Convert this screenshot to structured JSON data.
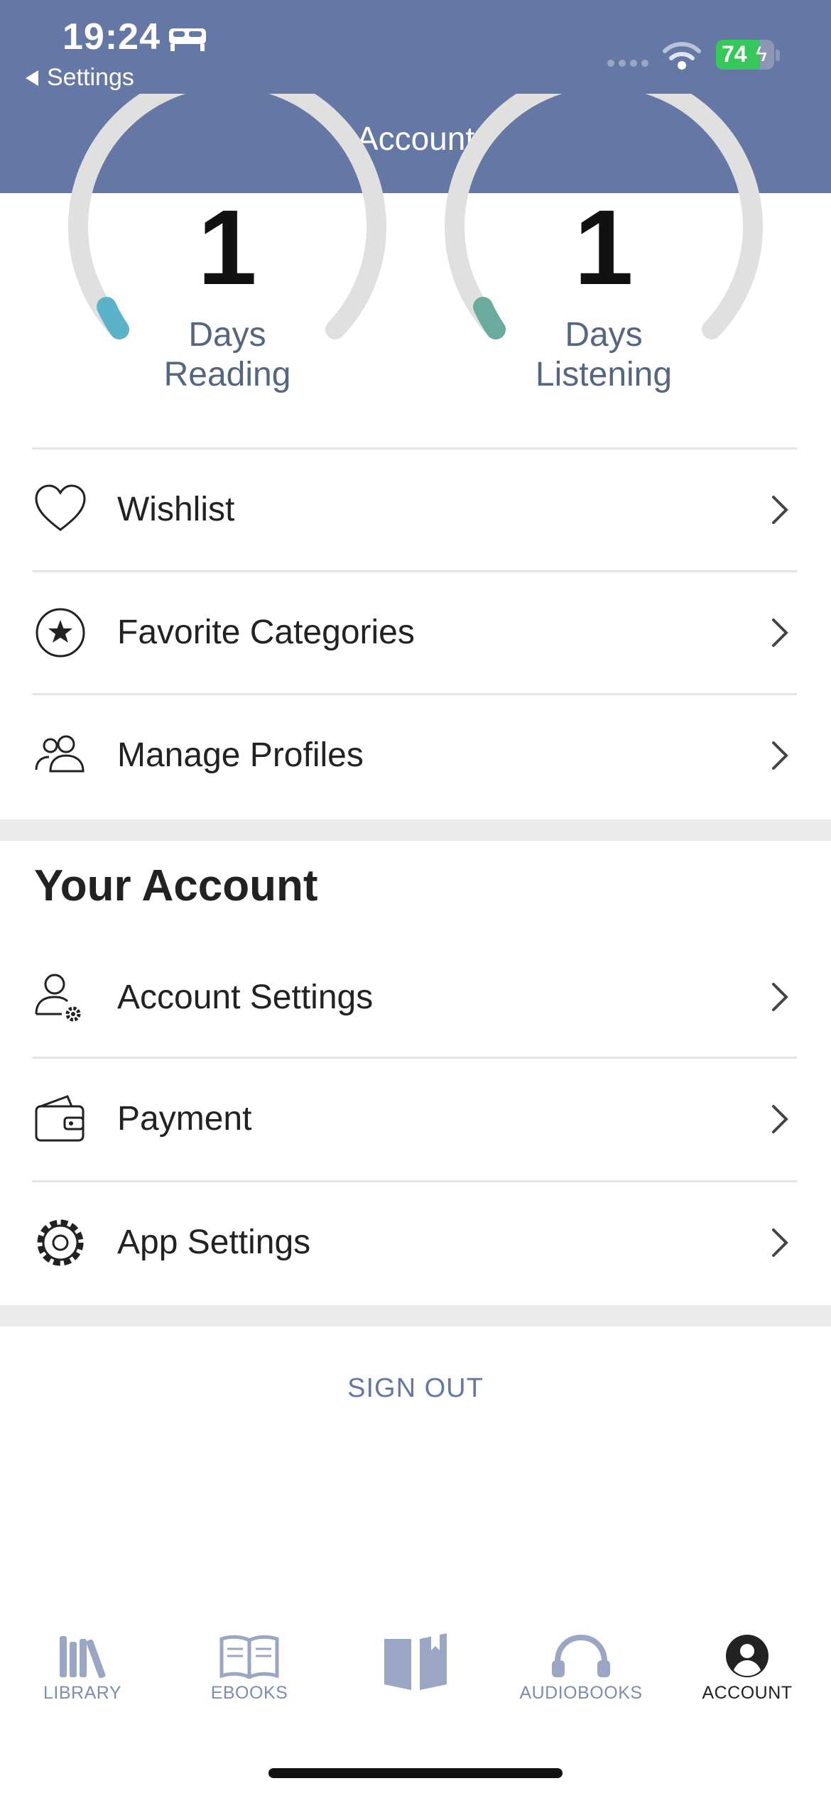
{
  "status_bar": {
    "time": "19:24",
    "back_label": "Settings",
    "battery": "74",
    "colors": {
      "header_bg": "#6577a4",
      "battery": "#35c759"
    }
  },
  "header": {
    "title": "Account"
  },
  "stats": [
    {
      "number": "1",
      "label_line1": "Days",
      "label_line2": "Reading",
      "accent": "#5bb3c9"
    },
    {
      "number": "1",
      "label_line1": "Days",
      "label_line2": "Listening",
      "accent": "#6aab9d"
    }
  ],
  "menu": [
    {
      "label": "Wishlist",
      "icon": "heart-icon"
    },
    {
      "label": "Favorite Categories",
      "icon": "star-circle-icon"
    },
    {
      "label": "Manage Profiles",
      "icon": "profiles-icon"
    }
  ],
  "account_section": {
    "title": "Your Account",
    "items": [
      {
        "label": "Account Settings",
        "icon": "user-gear-icon"
      },
      {
        "label": "Payment",
        "icon": "wallet-icon"
      },
      {
        "label": "App Settings",
        "icon": "gear-icon"
      }
    ]
  },
  "sign_out": "SIGN OUT",
  "tab_bar": {
    "tabs": [
      {
        "label": "LIBRARY",
        "icon": "library-icon"
      },
      {
        "label": "EBOOKS",
        "icon": "ebook-icon"
      },
      {
        "label": "",
        "icon": "open-book-icon"
      },
      {
        "label": "AUDIOBOOKS",
        "icon": "headphones-icon"
      },
      {
        "label": "ACCOUNT",
        "icon": "account-icon",
        "active": true
      }
    ],
    "colors": {
      "inactive": "#9aa6c4",
      "active": "#222222"
    }
  }
}
